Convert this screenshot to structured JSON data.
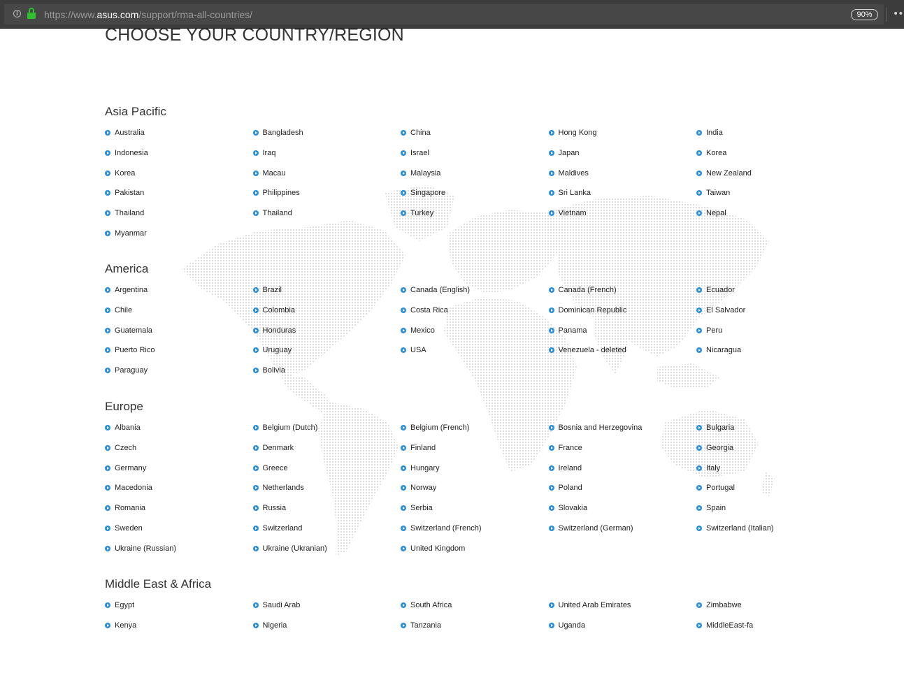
{
  "browser": {
    "url_prefix": "https://www.",
    "url_host": "asus.com",
    "url_path": "/support/rma-all-countries/",
    "zoom": "90%"
  },
  "page": {
    "title": "CHOOSE YOUR COUNTRY/REGION"
  },
  "regions": [
    {
      "name": "Asia Pacific",
      "countries": [
        "Australia",
        "Bangladesh",
        "China",
        "Hong Kong",
        "India",
        "Indonesia",
        "Iraq",
        "Israel",
        "Japan",
        "Korea",
        "Korea",
        "Macau",
        "Malaysia",
        "Maldives",
        "New Zealand",
        "Pakistan",
        "Philippines",
        "Singapore",
        "Sri Lanka",
        "Taiwan",
        "Thailand",
        "Thailand",
        "Turkey",
        "Vietnam",
        "Nepal",
        "Myanmar"
      ]
    },
    {
      "name": "America",
      "countries": [
        "Argentina",
        "Brazil",
        "Canada (English)",
        "Canada (French)",
        "Ecuador",
        "Chile",
        "Colombia",
        "Costa Rica",
        "Dominican Republic",
        "El Salvador",
        "Guatemala",
        "Honduras",
        "Mexico",
        "Panama",
        "Peru",
        "Puerto Rico",
        "Uruguay",
        "USA",
        "Venezuela - deleted",
        "Nicaragua",
        "Paraguay",
        "Bolivia"
      ]
    },
    {
      "name": "Europe",
      "countries": [
        "Albania",
        "Belgium (Dutch)",
        "Belgium (French)",
        "Bosnia and Herzegovina",
        "Bulgaria",
        "Czech",
        "Denmark",
        "Finland",
        "France",
        "Georgia",
        "Germany",
        "Greece",
        "Hungary",
        "Ireland",
        "Italy",
        "Macedonia",
        "Netherlands",
        "Norway",
        "Poland",
        "Portugal",
        "Romania",
        "Russia",
        "Serbia",
        "Slovakia",
        "Spain",
        "Sweden",
        "Switzerland",
        "Switzerland (French)",
        "Switzerland (German)",
        "Switzerland (Italian)",
        "Ukraine (Russian)",
        "Ukraine (Ukranian)",
        "United Kingdom"
      ]
    },
    {
      "name": "Middle East & Africa",
      "countries": [
        "Egypt",
        "Saudi Arab",
        "South Africa",
        "United Arab Emirates",
        "Zimbabwe",
        "Kenya",
        "Nigeria",
        "Tanzania",
        "Uganda",
        "MiddleEast-fa"
      ]
    }
  ],
  "colors": {
    "bullet": "#2a8fd8",
    "map_dot": "#d9d9d9",
    "lock": "#2fbf2f"
  }
}
